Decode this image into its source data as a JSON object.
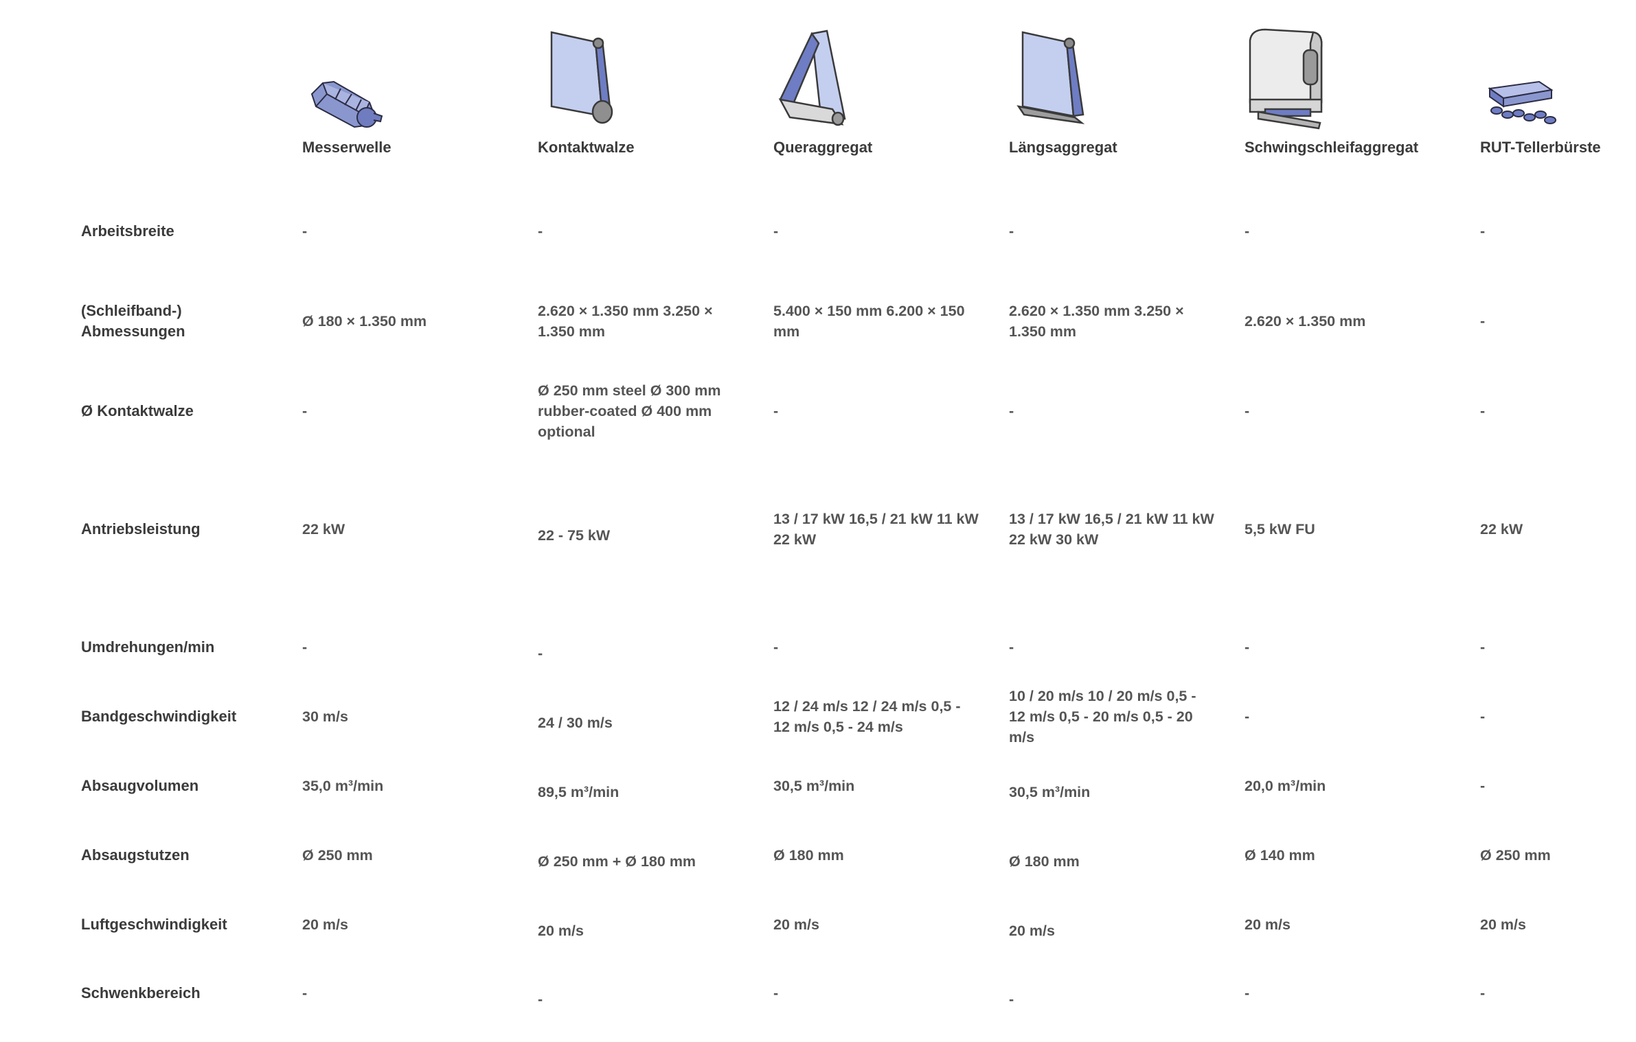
{
  "columns": [
    {
      "name": "Messerwelle",
      "icon": "knife-shaft-icon"
    },
    {
      "name": "Kontaktwalze",
      "icon": "contact-roller-icon"
    },
    {
      "name": "Queraggregat",
      "icon": "cross-unit-icon"
    },
    {
      "name": "Längsaggregat",
      "icon": "longitudinal-unit-icon"
    },
    {
      "name": "Schwingschleifaggregat",
      "icon": "oscillating-sander-icon"
    },
    {
      "name": "RUT-Tellerbürste",
      "icon": "disc-brush-icon"
    }
  ],
  "rows": [
    {
      "label": "Arbeitsbreite",
      "values": [
        "-",
        "-",
        "-",
        "-",
        "-",
        "-"
      ]
    },
    {
      "label": "(Schleifband-) Abmessungen",
      "values": [
        "Ø 180 × 1.350 mm",
        "2.620 × 1.350 mm 3.250 × 1.350 mm",
        "5.400 × 150 mm 6.200 × 150 mm",
        "2.620 × 1.350 mm 3.250 × 1.350 mm",
        "2.620 × 1.350 mm",
        "-"
      ]
    },
    {
      "label": "Ø Kontaktwalze",
      "values": [
        "-",
        "Ø 250 mm steel Ø 300 mm rubber-coated Ø 400 mm optional",
        "-",
        "-",
        "-",
        "-"
      ]
    },
    {
      "label": "Antriebsleistung",
      "values": [
        "22 kW",
        "22 - 75 kW",
        "13 / 17 kW 16,5 / 21 kW 11 kW 22 kW",
        "13 / 17 kW 16,5 / 21 kW 11 kW 22 kW 30 kW",
        "5,5 kW FU",
        "22 kW"
      ]
    },
    {
      "label": "Umdrehungen/min",
      "values": [
        "-",
        "-",
        "-",
        "-",
        "-",
        "-"
      ]
    },
    {
      "label": "Bandgeschwindigkeit",
      "values": [
        "30 m/s",
        "24 / 30 m/s",
        "12 / 24 m/s 12 / 24 m/s 0,5 - 12 m/s 0,5 - 24 m/s",
        "10 / 20 m/s 10 / 20 m/s 0,5 - 12 m/s 0,5 - 20 m/s 0,5 - 20 m/s",
        "-",
        "-"
      ]
    },
    {
      "label": "Absaugvolumen",
      "values": [
        "35,0 m³/min",
        "89,5 m³/min",
        "30,5 m³/min",
        "30,5 m³/min",
        "20,0 m³/min",
        "-"
      ]
    },
    {
      "label": "Absaugstutzen",
      "values": [
        "Ø 250 mm",
        "Ø 250 mm + Ø 180 mm",
        "Ø 180 mm",
        "Ø 180 mm",
        "Ø 140 mm",
        "Ø 250 mm"
      ]
    },
    {
      "label": "Luftgeschwindigkeit",
      "values": [
        "20 m/s",
        "20 m/s",
        "20 m/s",
        "20 m/s",
        "20 m/s",
        "20 m/s"
      ]
    },
    {
      "label": "Schwenkbereich",
      "values": [
        "-",
        "-",
        "-",
        "-",
        "-",
        "-"
      ]
    }
  ]
}
